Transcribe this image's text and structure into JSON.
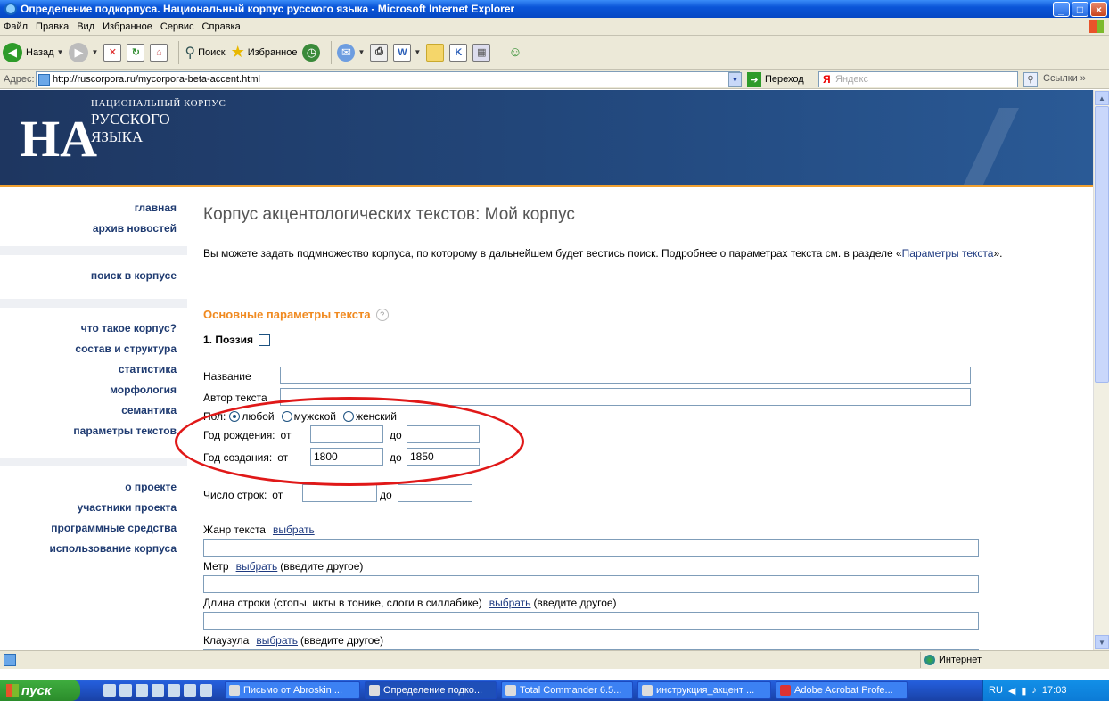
{
  "window": {
    "title": "Определение подкорпуса. Национальный корпус русского языка - Microsoft Internet Explorer",
    "buttons": {
      "minimize": "_",
      "maximize": "□",
      "close": "×"
    }
  },
  "menu": [
    "Файл",
    "Правка",
    "Вид",
    "Избранное",
    "Сервис",
    "Справка"
  ],
  "toolbar": {
    "back": "Назад",
    "search": "Поиск",
    "favorites": "Избранное"
  },
  "address": {
    "label": "Адрес:",
    "url": "http://ruscorpora.ru/mycorpora-beta-accent.html",
    "go": "Переход",
    "yandex_placeholder": "Яндекс",
    "links": "Ссылки »"
  },
  "site": {
    "logo": "НА",
    "name_line1": "НАЦИОНАЛЬНЫЙ КОРПУС",
    "name_line2": "РУССКОГО",
    "name_line3": "ЯЗЫКА"
  },
  "sidebar": {
    "groups": [
      [
        "главная",
        "архив новостей"
      ],
      [
        "поиск в корпусе"
      ],
      [
        "что такое корпус?",
        "состав и структура",
        "статистика",
        "морфология",
        "семантика",
        "параметры текстов"
      ],
      [
        "о проекте",
        "участники проекта",
        "программные средства",
        "использование корпуса"
      ]
    ]
  },
  "content": {
    "title": "Корпус акцентологических текстов: Мой корпус",
    "intro_before": "Вы можете задать подмножество корпуса, по которому в дальнейшем будет вестись поиск. Подробнее о параметрах текста см. в разделе «",
    "intro_link": "Параметры текста",
    "intro_after": "».",
    "section_title": "Основные параметры текста",
    "help": "?",
    "poetry_label": "1. Поэзия",
    "title_label": "Название",
    "author_label": "Автор текста",
    "sex_label": "Пол:",
    "sex_options": [
      "любой",
      "мужской",
      "женский"
    ],
    "birth_label": "Год рождения:",
    "creation_label": "Год создания:",
    "from": "от",
    "to": "до",
    "creation_from_value": "1800",
    "creation_to_value": "1850",
    "lines_label": "Число строк:",
    "genre_label": "Жанр текста",
    "choose": "выбрать",
    "meter_label": "Метр",
    "enter_other": "(введите другое)",
    "line_length_label": "Длина строки (стопы, икты в тонике, слоги в силлабике)",
    "clausula_label": "Клаузула"
  },
  "status": {
    "zone": "Интернет"
  },
  "taskbar": {
    "start": "пуск",
    "tasks": [
      "Письмо от Abroskin ...",
      "Определение подко...",
      "Total Commander 6.5...",
      "инструкция_акцент ...",
      "Adobe Acrobat Profe..."
    ],
    "lang": "RU",
    "time": "17:03"
  },
  "colors": {
    "accent_orange": "#f08a20",
    "header_blue": "#234a80",
    "highlight_red": "#e01818"
  }
}
